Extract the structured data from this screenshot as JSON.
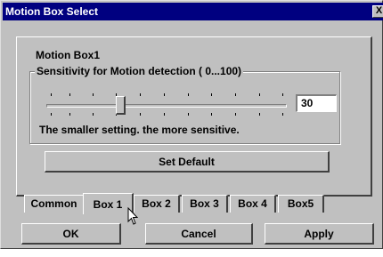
{
  "window": {
    "title": "Motion Box Select",
    "close_label": "X"
  },
  "panel": {
    "box_title": "Motion Box1",
    "group_label": "Sensitivity for Motion detection  ( 0...100)",
    "sensitivity_value": "30",
    "slider_level_percent": 30,
    "hint": "The smaller setting. the more sensitive.",
    "set_default_label": "Set Default"
  },
  "tabs": [
    {
      "label": "Common",
      "active": false
    },
    {
      "label": "Box 1",
      "active": true
    },
    {
      "label": "Box 2",
      "active": false
    },
    {
      "label": "Box 3",
      "active": false
    },
    {
      "label": "Box 4",
      "active": false
    },
    {
      "label": "Box5",
      "active": false
    }
  ],
  "buttons": {
    "ok": "OK",
    "cancel": "Cancel",
    "apply": "Apply"
  },
  "colors": {
    "face": "#c0c0c0",
    "titlebar": "#000080"
  }
}
